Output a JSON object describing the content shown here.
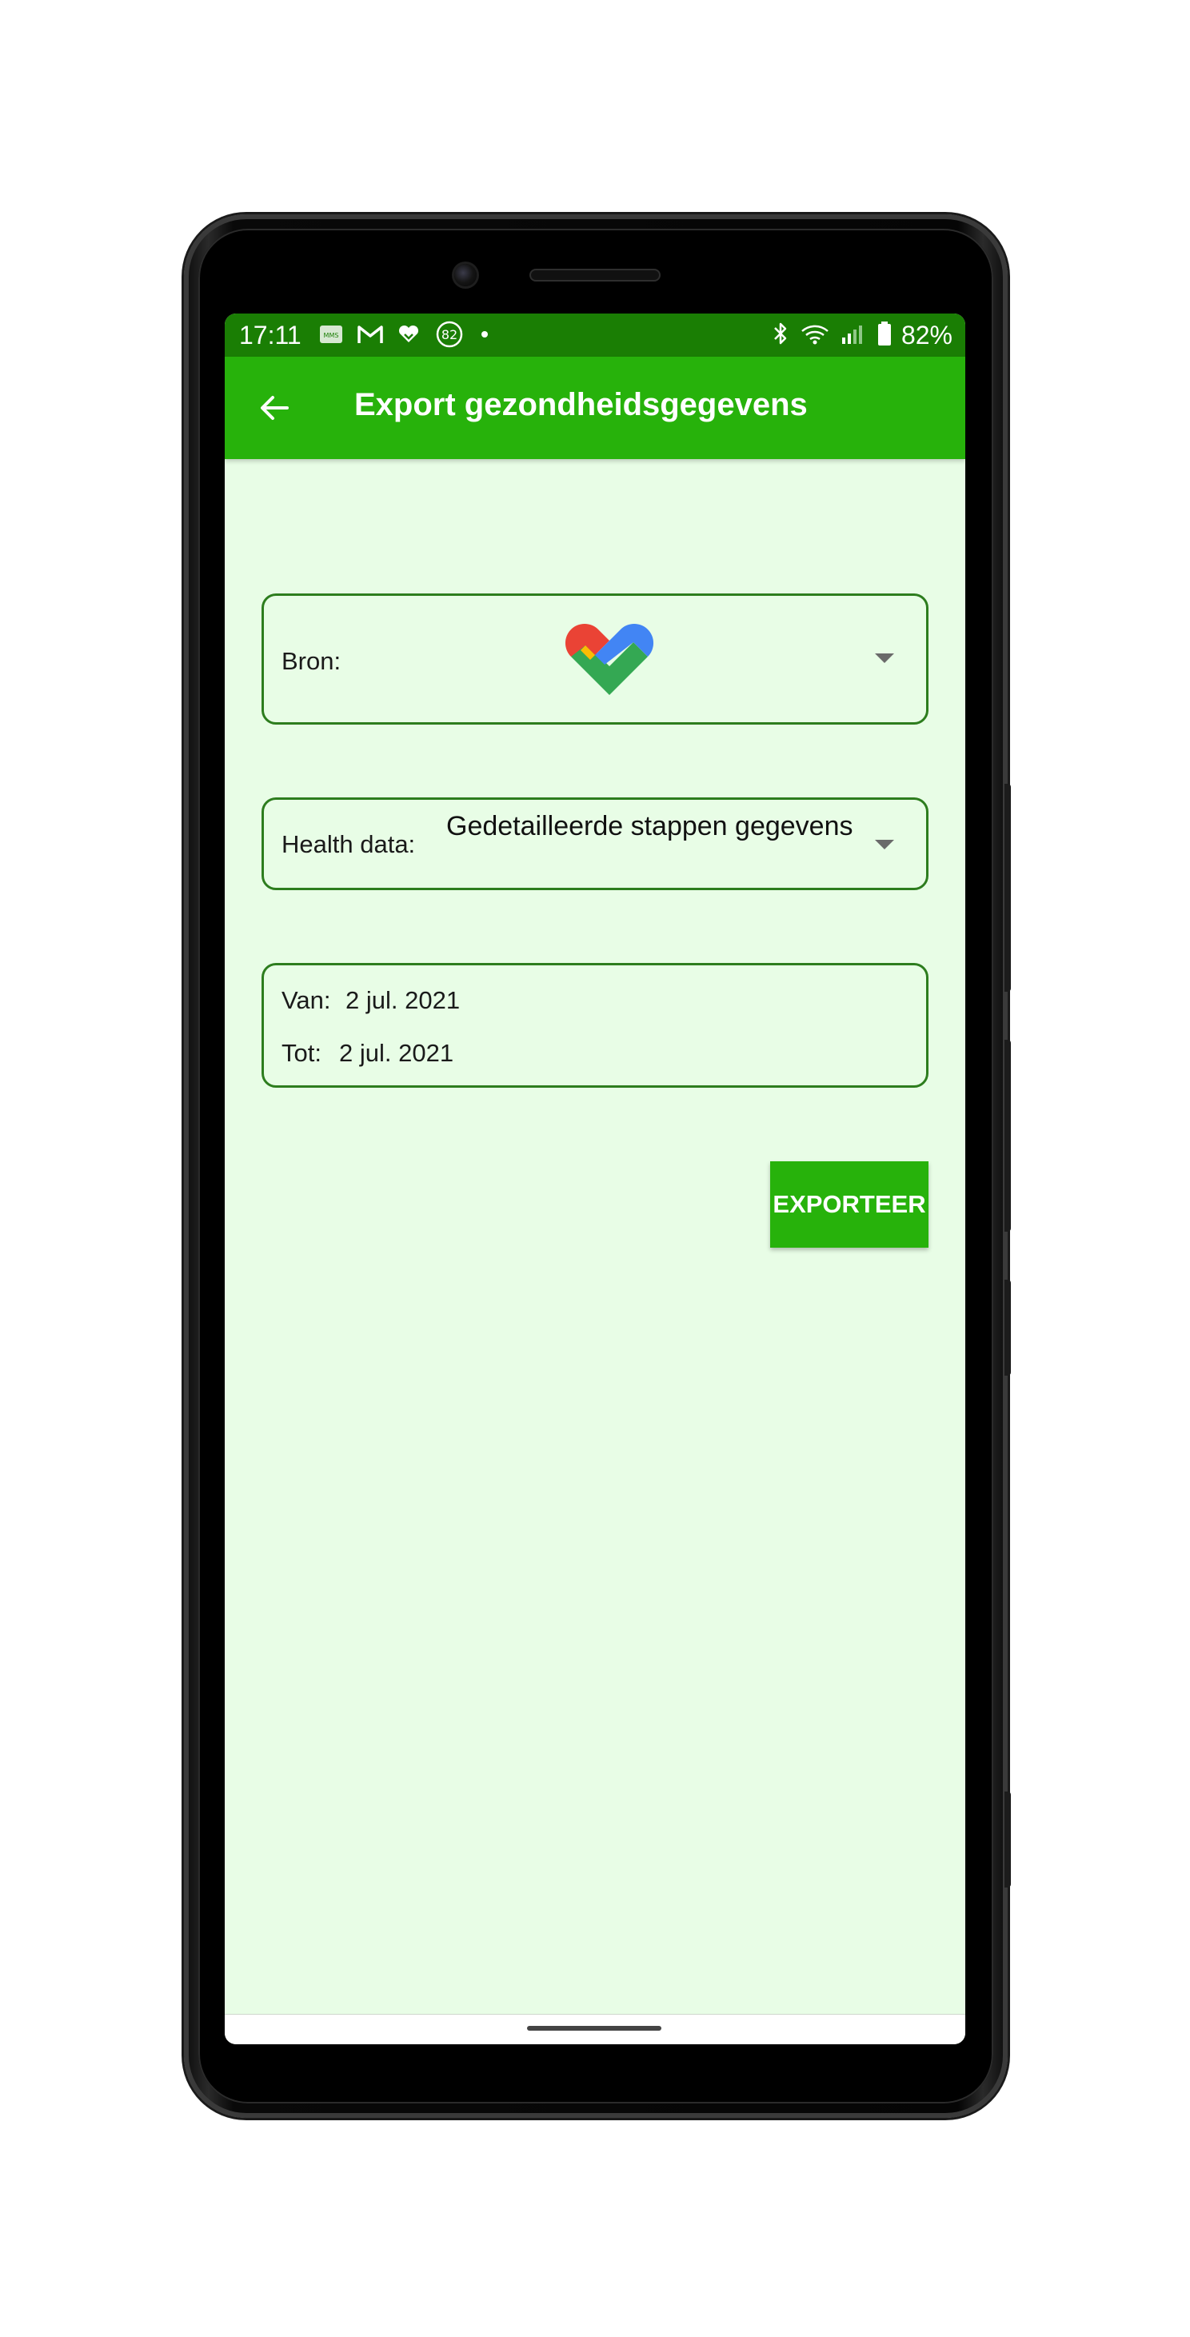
{
  "status_bar": {
    "time": "17:11",
    "notification_icons": [
      "sms-icon",
      "gmail-icon",
      "fit-heart-icon",
      "badge-82-icon",
      "dot-icon"
    ],
    "badge_count": "82",
    "battery_percent": "82%",
    "right_icons": [
      "bluetooth-icon",
      "wifi-icon",
      "signal-icon",
      "battery-icon"
    ],
    "color": "#1a7e04"
  },
  "app_bar": {
    "title": "Export gezondheidsgegevens",
    "color": "#27b20b"
  },
  "source": {
    "label": "Bron:",
    "selected_icon": "google-fit-logo"
  },
  "health_data": {
    "label": "Health data:",
    "value": "Gedetailleerde stappen gegevens"
  },
  "date_range": {
    "from_label": "Van:",
    "from_value": "2 jul. 2021",
    "to_label": "Tot:",
    "to_value": "2 jul. 2021"
  },
  "actions": {
    "export_label": "EXPORTEER"
  },
  "theme": {
    "background": "#e8fde6",
    "border": "#2d7d1e"
  }
}
